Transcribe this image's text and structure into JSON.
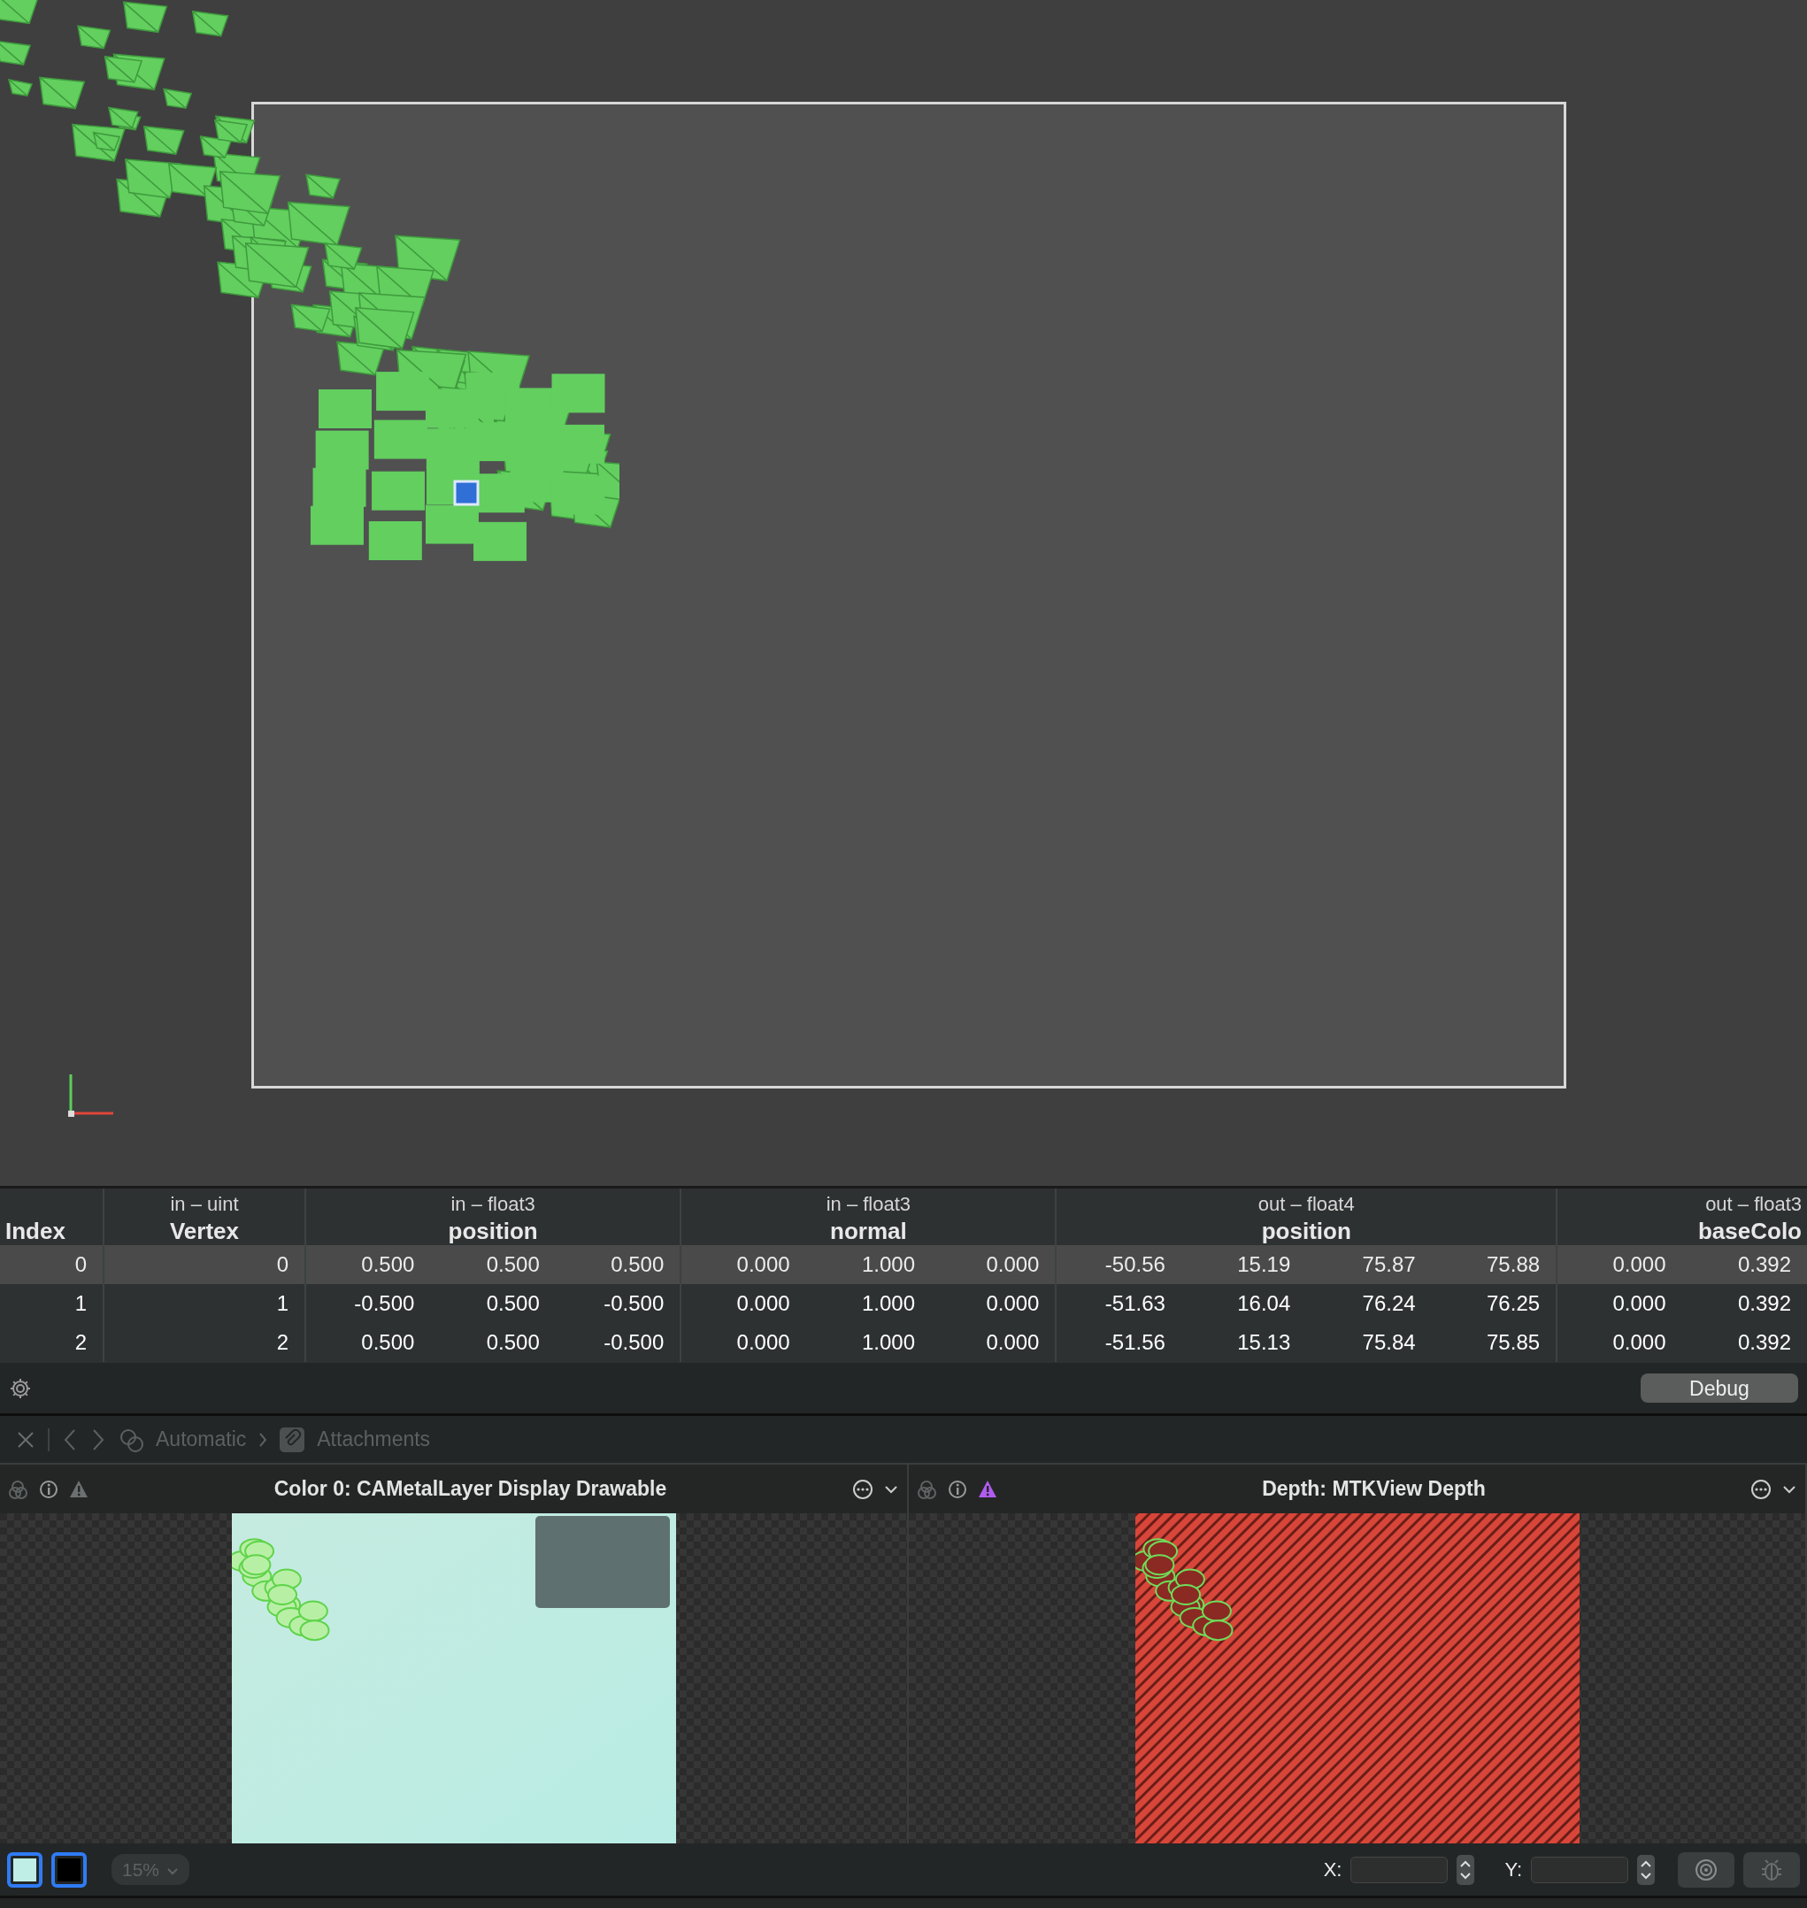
{
  "table": {
    "columns": [
      {
        "name": "Index"
      },
      {
        "type": "in – uint",
        "name": "Vertex"
      },
      {
        "type": "in – float3",
        "name": "position"
      },
      {
        "type": "in – float3",
        "name": "normal"
      },
      {
        "type": "out – float4",
        "name": "position"
      },
      {
        "type": "out – float3",
        "name": "baseColo"
      }
    ],
    "rows": [
      {
        "selected": true,
        "cells": [
          [
            "0"
          ],
          [
            "0"
          ],
          [
            "0.500",
            "0.500",
            "0.500"
          ],
          [
            "0.000",
            "1.000",
            "0.000"
          ],
          [
            "-50.56",
            "15.19",
            "75.87",
            "75.88"
          ],
          [
            "0.000",
            "0.392"
          ]
        ]
      },
      {
        "selected": false,
        "cells": [
          [
            "1"
          ],
          [
            "1"
          ],
          [
            "-0.500",
            "0.500",
            "-0.500"
          ],
          [
            "0.000",
            "1.000",
            "0.000"
          ],
          [
            "-51.63",
            "16.04",
            "76.24",
            "76.25"
          ],
          [
            "0.000",
            "0.392"
          ]
        ]
      },
      {
        "selected": false,
        "cells": [
          [
            "2"
          ],
          [
            "2"
          ],
          [
            "0.500",
            "0.500",
            "-0.500"
          ],
          [
            "0.000",
            "1.000",
            "0.000"
          ],
          [
            "-51.56",
            "15.13",
            "75.84",
            "75.85"
          ],
          [
            "0.000",
            "0.392"
          ]
        ]
      }
    ]
  },
  "toolbar": {
    "button": "Debug"
  },
  "navigator": {
    "items": [
      {
        "kind": "automatic",
        "label": "Automatic",
        "disabled": true
      },
      {
        "kind": "attachments",
        "label": "Attachments",
        "disabled": true
      }
    ]
  },
  "attachments": [
    {
      "kind": "color",
      "title": "Color 0: CAMetalLayer Display Drawable",
      "warning": false
    },
    {
      "kind": "depth",
      "title": "Depth: MTKView Depth",
      "warning": true
    }
  ],
  "bottom_bar": {
    "swatches": [
      {
        "color": "#bfeee6"
      },
      {
        "color": "#000000"
      }
    ],
    "zoom": "15%",
    "x_label": "X:",
    "y_label": "Y:"
  }
}
